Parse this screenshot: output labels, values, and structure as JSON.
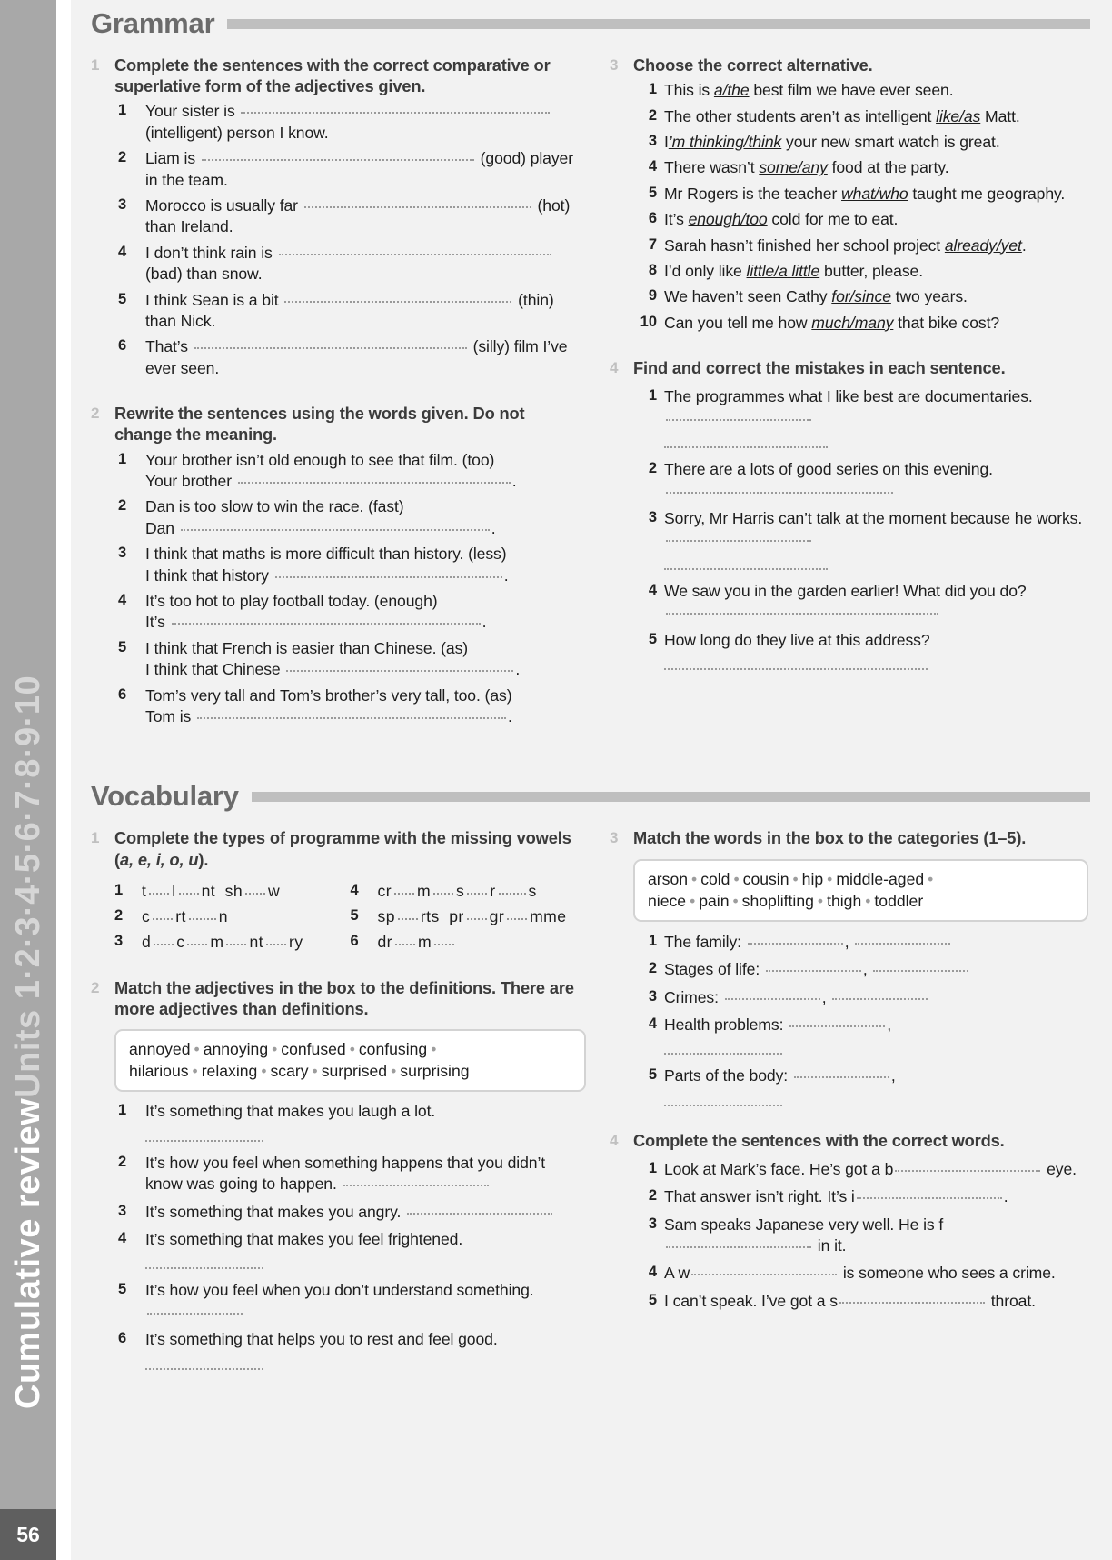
{
  "side_tab": {
    "label_main": "Cumulative review ",
    "label_units": "Units 1·2·3·4·5·6·7·8·9·10",
    "page_number": "56"
  },
  "sections": {
    "grammar": {
      "title": "Grammar"
    },
    "vocabulary": {
      "title": "Vocabulary"
    }
  },
  "grammar": {
    "ex1": {
      "num": "1",
      "title": "Complete the sentences with the correct comparative or superlative form of the adjectives given.",
      "items": [
        {
          "n": "1",
          "pre": "Your sister is",
          "post": "(intelligent) person I know."
        },
        {
          "n": "2",
          "pre": "Liam is",
          "post": "(good) player in the team."
        },
        {
          "n": "3",
          "pre": "Morocco is usually far",
          "post": "(hot) than Ireland."
        },
        {
          "n": "4",
          "pre": "I don’t think rain is",
          "post": "(bad) than snow."
        },
        {
          "n": "5",
          "pre": "I think Sean is a bit",
          "post": "(thin) than Nick."
        },
        {
          "n": "6",
          "pre": "That’s",
          "post": "(silly) film I’ve ever seen."
        }
      ]
    },
    "ex2": {
      "num": "2",
      "title": "Rewrite the sentences using the words given. Do not change the meaning.",
      "items": [
        {
          "n": "1",
          "prompt": "Your brother isn’t old enough to see that film. (too)",
          "answer_start": "Your brother"
        },
        {
          "n": "2",
          "prompt": "Dan is too slow to win the race. (fast)",
          "answer_start": "Dan"
        },
        {
          "n": "3",
          "prompt": "I think that maths is more difficult than history. (less)",
          "answer_start": "I think that history"
        },
        {
          "n": "4",
          "prompt": "It’s too hot to play football today. (enough)",
          "answer_start": "It’s"
        },
        {
          "n": "5",
          "prompt": "I think that French is easier than Chinese. (as)",
          "answer_start": "I think that Chinese"
        },
        {
          "n": "6",
          "prompt": "Tom’s very tall and Tom’s brother’s very tall, too. (as)",
          "answer_start": "Tom is"
        }
      ]
    },
    "ex3": {
      "num": "3",
      "title": "Choose the correct alternative.",
      "items": [
        {
          "n": "1",
          "pre": "This is ",
          "alt": "a/the",
          "post": " best film we have ever seen."
        },
        {
          "n": "2",
          "pre": "The other students aren’t as intelligent ",
          "alt": "like/as",
          "post": " Matt."
        },
        {
          "n": "3",
          "pre": "I",
          "alt": "’m thinking/think",
          "post": " your new smart watch is great."
        },
        {
          "n": "4",
          "pre": "There wasn’t ",
          "alt": "some/any",
          "post": " food at the party."
        },
        {
          "n": "5",
          "pre": "Mr Rogers is the teacher ",
          "alt": "what/who",
          "post": " taught me geography."
        },
        {
          "n": "6",
          "pre": "It’s ",
          "alt": "enough/too",
          "post": " cold for me to eat."
        },
        {
          "n": "7",
          "pre": "Sarah hasn’t finished her school project ",
          "alt": "already/yet",
          "post": "."
        },
        {
          "n": "8",
          "pre": "I’d only like ",
          "alt": "little/a little",
          "post": " butter, please."
        },
        {
          "n": "9",
          "pre": "We haven’t seen Cathy ",
          "alt": "for/since",
          "post": " two years."
        },
        {
          "n": "10",
          "pre": "Can you tell me how ",
          "alt": "much/many",
          "post": " that bike cost?"
        }
      ]
    },
    "ex4": {
      "num": "4",
      "title": "Find and correct the mistakes in each sentence.",
      "items": [
        {
          "n": "1",
          "text": "The programmes what I like best are documentaries."
        },
        {
          "n": "2",
          "text": "There are a lots of good series on this evening."
        },
        {
          "n": "3",
          "text": "Sorry, Mr Harris can’t talk at the moment because he works."
        },
        {
          "n": "4",
          "text": "We saw you in the garden earlier! What did you do?"
        },
        {
          "n": "5",
          "text": "How long do they live at this address?"
        }
      ]
    }
  },
  "vocabulary": {
    "ex1": {
      "num": "1",
      "title_a": "Complete the types of programme with the missing vowels (",
      "title_vowels": "a, e, i, o, u",
      "title_b": ").",
      "items_left": [
        {
          "n": "1",
          "parts": [
            "t",
            "l",
            "nt  sh",
            "w"
          ],
          "gaps": [
            "g2",
            "g2",
            "g2"
          ]
        },
        {
          "n": "2",
          "parts": [
            "c",
            "rt",
            "n"
          ],
          "gaps": [
            "g2",
            "g3"
          ]
        },
        {
          "n": "3",
          "parts": [
            "d",
            "c",
            "m",
            "nt",
            "ry"
          ],
          "gaps": [
            "g2",
            "g2",
            "g2",
            "g2"
          ]
        }
      ],
      "items_right": [
        {
          "n": "4",
          "parts": [
            "cr",
            "m",
            "s",
            "r",
            "s"
          ],
          "gaps": [
            "g2",
            "g2",
            "g2",
            "g3"
          ]
        },
        {
          "n": "5",
          "parts": [
            "sp",
            "rts  pr",
            "gr",
            "mme"
          ],
          "gaps": [
            "g2",
            "g2",
            "g2"
          ]
        },
        {
          "n": "6",
          "parts": [
            "dr",
            "m",
            ""
          ],
          "gaps": [
            "g2",
            "g2"
          ]
        }
      ]
    },
    "ex2": {
      "num": "2",
      "title": "Match the adjectives in the box to the definitions. There are more adjectives than definitions.",
      "box_words": [
        "annoyed",
        "annoying",
        "confused",
        "confusing",
        "hilarious",
        "relaxing",
        "scary",
        "surprised",
        "surprising"
      ],
      "items": [
        {
          "n": "1",
          "text": "It’s something that makes you laugh a lot."
        },
        {
          "n": "2",
          "text": "It’s how you feel when something happens that you didn’t know was going to happen."
        },
        {
          "n": "3",
          "text": "It’s something that makes you angry."
        },
        {
          "n": "4",
          "text": "It’s something that makes you feel frightened."
        },
        {
          "n": "5",
          "text": "It’s how you feel when you don’t understand something."
        },
        {
          "n": "6",
          "text": "It’s something that helps you to rest and feel good."
        }
      ]
    },
    "ex3": {
      "num": "3",
      "title": "Match the words in the box to the categories (1–5).",
      "box_words": [
        "arson",
        "cold",
        "cousin",
        "hip",
        "middle-aged",
        "niece",
        "pain",
        "shoplifting",
        "thigh",
        "toddler"
      ],
      "items": [
        {
          "n": "1",
          "label": "The family:"
        },
        {
          "n": "2",
          "label": "Stages of life:"
        },
        {
          "n": "3",
          "label": "Crimes:"
        },
        {
          "n": "4",
          "label": "Health problems:"
        },
        {
          "n": "5",
          "label": "Parts of the body:"
        }
      ]
    },
    "ex4": {
      "num": "4",
      "title": "Complete the sentences with the correct words.",
      "items": [
        {
          "n": "1",
          "pre": "Look at Mark’s face. He’s got a b",
          "post": "eye."
        },
        {
          "n": "2",
          "pre": "That answer isn’t right. It’s i",
          "post": "."
        },
        {
          "n": "3",
          "pre": "Sam speaks Japanese very well. He is f",
          "post": "in it."
        },
        {
          "n": "4",
          "pre": "A w",
          "post": "is someone who sees a crime."
        },
        {
          "n": "5",
          "pre": "I can’t speak. I’ve got a s",
          "post": "throat."
        }
      ]
    }
  }
}
